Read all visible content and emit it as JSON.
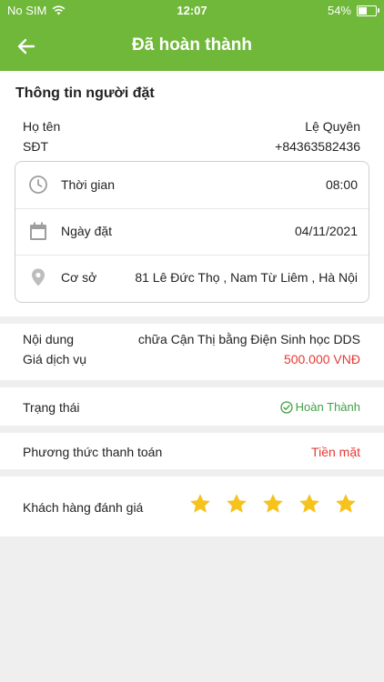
{
  "status_bar": {
    "carrier": "No SIM",
    "time": "12:07",
    "battery": "54%",
    "battery_level": 0.54
  },
  "header": {
    "title": "Đã hoàn thành"
  },
  "customer": {
    "section_title": "Thông tin người đặt",
    "name_label": "Họ tên",
    "name_value": "Lệ Quyên",
    "phone_label": "SĐT",
    "phone_value": "+84363582436"
  },
  "booking": {
    "time_label": "Thời gian",
    "time_value": "08:00",
    "date_label": "Ngày đặt",
    "date_value": "04/11/2021",
    "location_label": "Cơ sở",
    "location_value": "81 Lê Đức Thọ , Nam Từ Liêm , Hà Nội"
  },
  "service": {
    "content_label": "Nội dung",
    "content_value": "chữa Cận Thị bằng Điện Sinh học DDS",
    "price_label": "Giá dịch vụ",
    "price_value": "500.000 VNĐ"
  },
  "status": {
    "label": "Trạng thái",
    "value": "Hoàn Thành"
  },
  "payment": {
    "label": "Phương thức thanh toán",
    "value": "Tiền mặt"
  },
  "rating": {
    "label": "Khách hàng đánh giá",
    "stars": 5,
    "max_stars": 5
  },
  "colors": {
    "primary": "#6fb83a",
    "price": "#e53935",
    "status": "#43a047",
    "star": "#f6c21c"
  }
}
